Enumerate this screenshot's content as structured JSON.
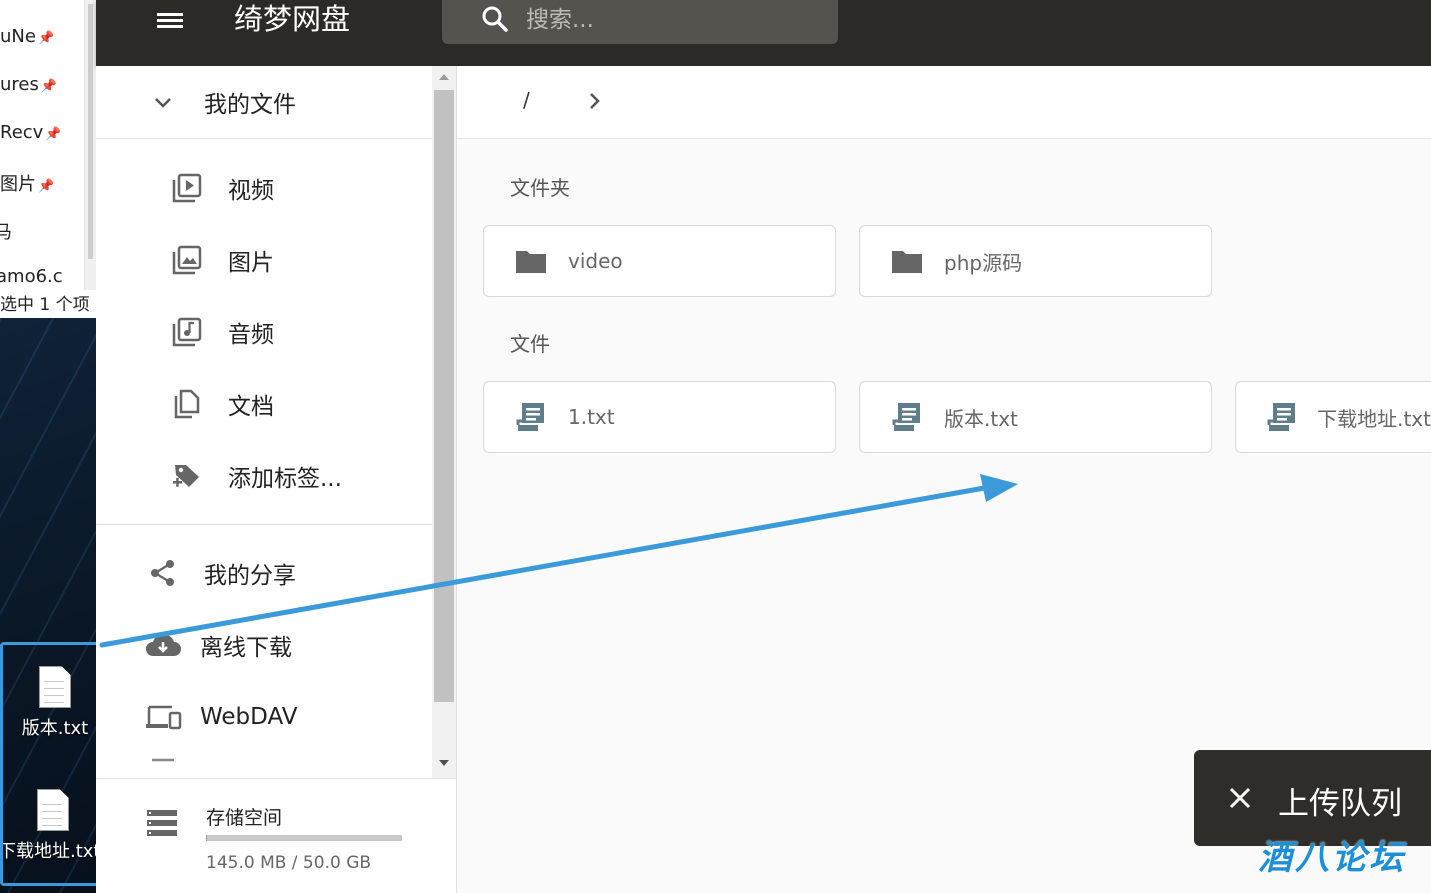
{
  "desktop": {
    "explorer_items": [
      {
        "label": "uNe"
      },
      {
        "label": "ures"
      },
      {
        "label": "Recv"
      },
      {
        "label": "图片"
      },
      {
        "label": "马"
      },
      {
        "label": "amo6.c"
      }
    ],
    "status_text": "选中 1 个项",
    "files": [
      {
        "label": "版本.txt"
      },
      {
        "label": "下载地址.txt"
      }
    ]
  },
  "header": {
    "title": "绮梦网盘",
    "search_placeholder": "搜索..."
  },
  "sidebar": {
    "my_files": "我的文件",
    "categories": [
      {
        "label": "视频",
        "icon": "video-library-icon"
      },
      {
        "label": "图片",
        "icon": "photo-library-icon"
      },
      {
        "label": "音频",
        "icon": "music-library-icon"
      },
      {
        "label": "文档",
        "icon": "documents-icon"
      },
      {
        "label": "添加标签...",
        "icon": "add-tag-icon"
      }
    ],
    "items": [
      {
        "label": "我的分享",
        "icon": "share-icon"
      },
      {
        "label": "离线下载",
        "icon": "cloud-download-icon"
      },
      {
        "label": "WebDAV",
        "icon": "devices-icon"
      }
    ],
    "storage": {
      "label": "存储空间",
      "usage": "145.0 MB / 50.0 GB",
      "used_fraction": 0.003
    }
  },
  "main": {
    "breadcrumb_root": "/",
    "folders_title": "文件夹",
    "folders": [
      {
        "name": "video"
      },
      {
        "name": "php源码"
      }
    ],
    "files_title": "文件",
    "files": [
      {
        "name": "1.txt"
      },
      {
        "name": "版本.txt"
      },
      {
        "name": "下载地址.txt"
      }
    ]
  },
  "upload_queue": {
    "label": "上传队列"
  },
  "watermark": "酒八论坛",
  "colors": {
    "header_bg": "#2b2a26",
    "annotation": "#3b9ad9"
  }
}
